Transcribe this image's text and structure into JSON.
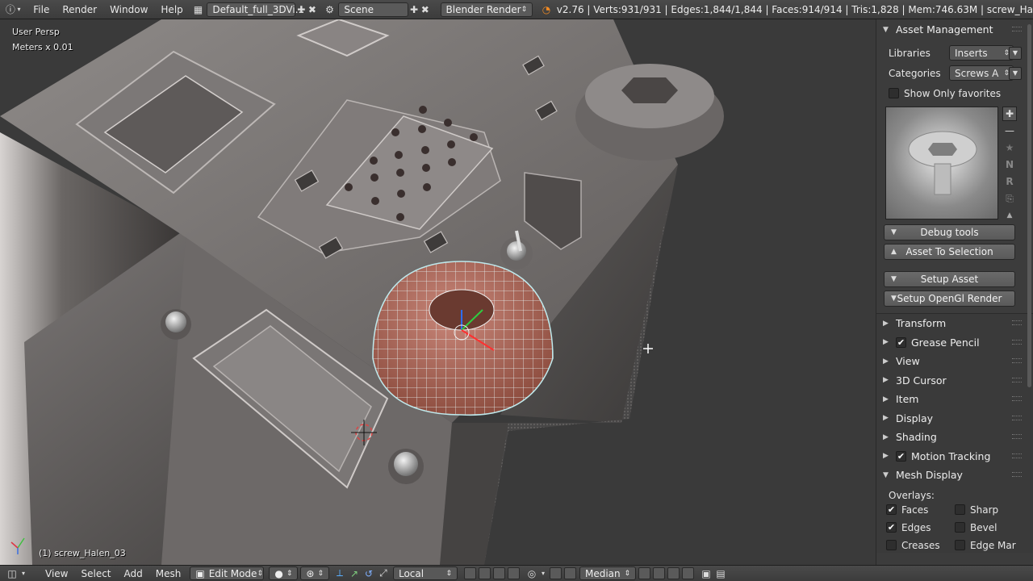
{
  "topbar": {
    "menus": [
      "File",
      "Render",
      "Window",
      "Help"
    ],
    "screen_layout": "Default_full_3DVi...",
    "scene": "Scene",
    "render_engine": "Blender Render",
    "stats": "v2.76 | Verts:931/931 | Edges:1,844/1,844 | Faces:914/914 | Tris:1,828 | Mem:746.63M | screw_Ha"
  },
  "viewport": {
    "view_name": "User Persp",
    "units": "Meters x 0.01",
    "active_object": "(1) screw_Halen_03"
  },
  "panel": {
    "asset_management": {
      "title": "Asset Management",
      "libraries_label": "Libraries",
      "libraries_value": "Inserts",
      "categories_label": "Categories",
      "categories_value": "Screws A",
      "favorites_label": "Show Only favorites",
      "side_letters": [
        "N",
        "R"
      ],
      "debug_tools": "Debug tools",
      "asset_to_selection": "Asset To Selection",
      "setup_asset": "Setup Asset",
      "setup_opengl": "Setup OpenGl Render"
    },
    "sections": [
      {
        "label": "Transform",
        "checkbox": false
      },
      {
        "label": "Grease Pencil",
        "checkbox": true
      },
      {
        "label": "View",
        "checkbox": false
      },
      {
        "label": "3D Cursor",
        "checkbox": false
      },
      {
        "label": "Item",
        "checkbox": false
      },
      {
        "label": "Display",
        "checkbox": false
      },
      {
        "label": "Shading",
        "checkbox": false
      },
      {
        "label": "Motion Tracking",
        "checkbox": true
      }
    ],
    "mesh_display": {
      "title": "Mesh Display",
      "overlays_label": "Overlays:",
      "items": [
        {
          "label": "Faces",
          "checked": true
        },
        {
          "label": "Sharp",
          "checked": false
        },
        {
          "label": "Edges",
          "checked": true
        },
        {
          "label": "Bevel",
          "checked": false
        },
        {
          "label": "Creases",
          "checked": false
        },
        {
          "label": "Edge Mar",
          "checked": false
        }
      ]
    }
  },
  "bottombar": {
    "menus": [
      "View",
      "Select",
      "Add",
      "Mesh"
    ],
    "mode": "Edit Mode",
    "orientation": "Local",
    "pivot": "Median"
  }
}
